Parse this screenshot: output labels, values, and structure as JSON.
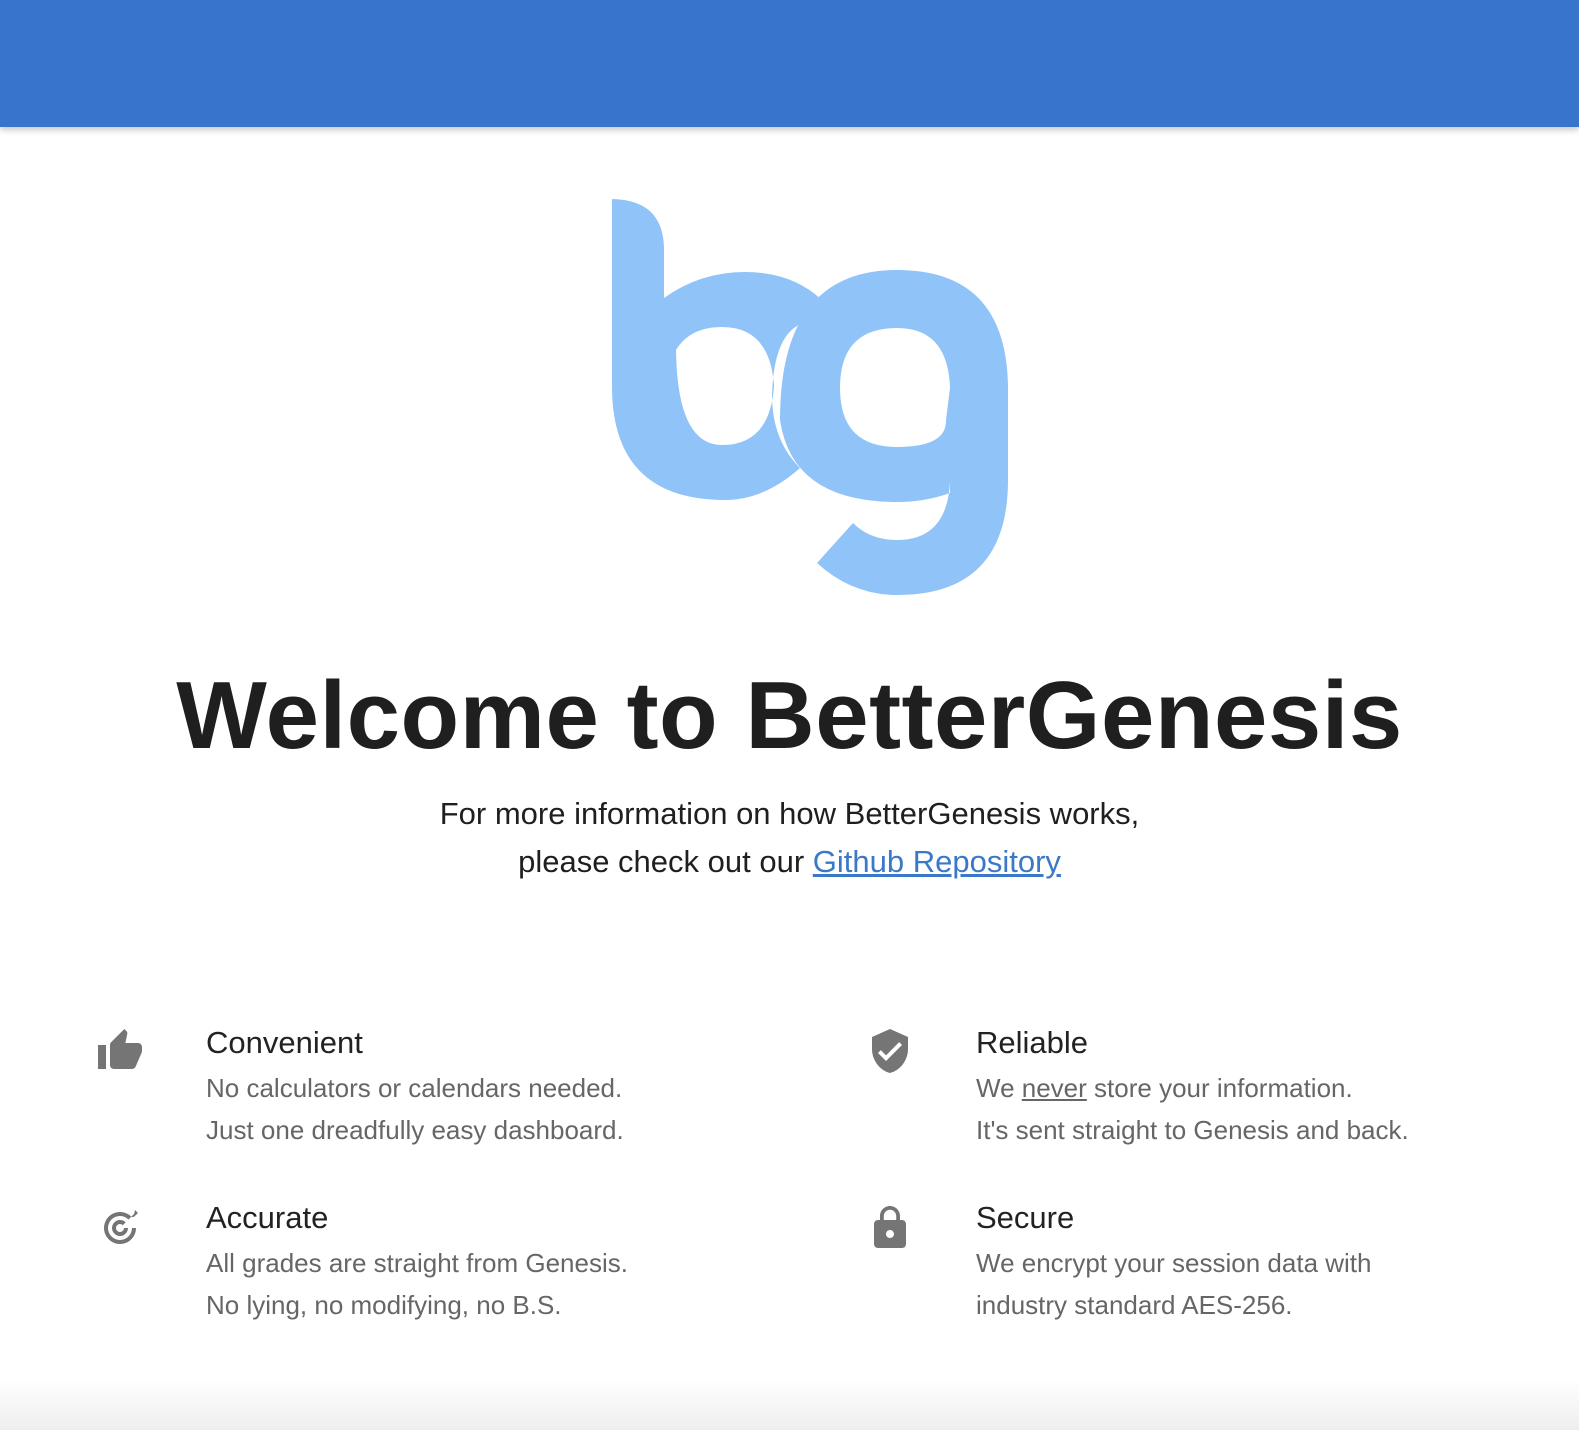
{
  "header": {
    "color": "#3874cb"
  },
  "logo": {
    "name": "bg-logo",
    "color": "#90c3f8"
  },
  "hero": {
    "title": "Welcome to BetterGenesis",
    "line1": "For more information on how BetterGenesis works,",
    "line2_prefix": "please check out our",
    "link_text": "Github Repository"
  },
  "features": [
    {
      "icon": "thumbs-up-icon",
      "title": "Convenient",
      "line1": "No calculators or calendars needed.",
      "line2": "Just one dreadfully easy dashboard."
    },
    {
      "icon": "verified-shield-icon",
      "title": "Reliable",
      "line1_prefix": "We",
      "line1_emph": "never",
      "line1_suffix": "store your information.",
      "line2": "It's sent straight to Genesis and back."
    },
    {
      "icon": "target-icon",
      "title": "Accurate",
      "line1": "All grades are straight from Genesis.",
      "line2": "No lying, no modifying, no B.S."
    },
    {
      "icon": "lock-icon",
      "title": "Secure",
      "line1": "We encrypt your session data with",
      "line2": "industry standard AES-256."
    }
  ]
}
